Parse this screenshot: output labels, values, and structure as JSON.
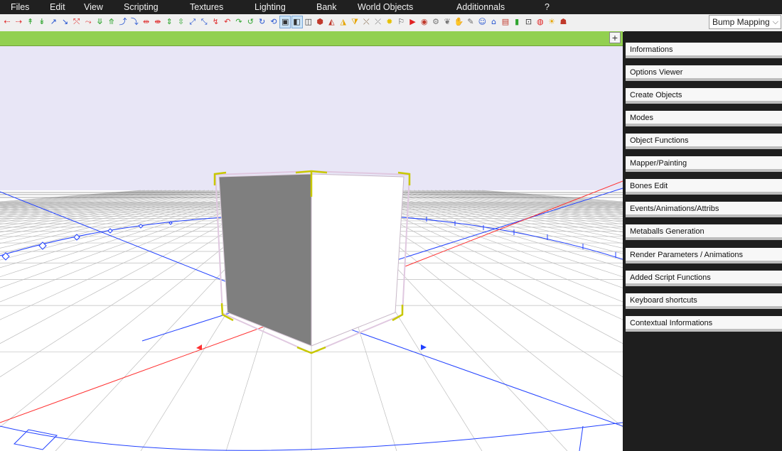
{
  "menu": [
    "Files",
    "Edit",
    "View",
    "Scripting",
    "Textures",
    "Lighting",
    "Bank",
    "World Objects",
    "Additionnals",
    "?"
  ],
  "toolbar": {
    "tools": [
      {
        "icon": "arrow-left-icon",
        "glyph": "⇠",
        "color": "#e03030"
      },
      {
        "icon": "arrow-right-icon",
        "glyph": "⇢",
        "color": "#e03030"
      },
      {
        "icon": "move-y-up-icon",
        "glyph": "↟",
        "color": "#2fa52f"
      },
      {
        "icon": "move-y-down-icon",
        "glyph": "↡",
        "color": "#2fa52f"
      },
      {
        "icon": "move-z-icon",
        "glyph": "↗",
        "color": "#2050d0"
      },
      {
        "icon": "move-z-back-icon",
        "glyph": "↘",
        "color": "#2050d0"
      },
      {
        "icon": "rotate-x-icon",
        "glyph": "⤲",
        "color": "#e03030"
      },
      {
        "icon": "rotate-x-back-icon",
        "glyph": "⤳",
        "color": "#e03030"
      },
      {
        "icon": "rotate-y-icon",
        "glyph": "⤋",
        "color": "#2fa52f"
      },
      {
        "icon": "rotate-y-back-icon",
        "glyph": "⤊",
        "color": "#2fa52f"
      },
      {
        "icon": "rotate-z-icon",
        "glyph": "⤴",
        "color": "#2050d0"
      },
      {
        "icon": "rotate-z-back-icon",
        "glyph": "⤵",
        "color": "#2050d0"
      },
      {
        "icon": "scale-x-icon",
        "glyph": "⇹",
        "color": "#e03030"
      },
      {
        "icon": "scale-x-down-icon",
        "glyph": "⇼",
        "color": "#e03030"
      },
      {
        "icon": "scale-y-icon",
        "glyph": "⇕",
        "color": "#2fa52f"
      },
      {
        "icon": "scale-y-down-icon",
        "glyph": "⇳",
        "color": "#2fa52f"
      },
      {
        "icon": "scale-z-icon",
        "glyph": "⤢",
        "color": "#2050d0"
      },
      {
        "icon": "scale-z-down-icon",
        "glyph": "⤡",
        "color": "#2050d0"
      },
      {
        "icon": "bend-x-icon",
        "glyph": "↯",
        "color": "#e03030"
      },
      {
        "icon": "bend-x-back-icon",
        "glyph": "↶",
        "color": "#e03030"
      },
      {
        "icon": "bend-y-icon",
        "glyph": "↷",
        "color": "#2fa52f"
      },
      {
        "icon": "bend-y-back-icon",
        "glyph": "↺",
        "color": "#2fa52f"
      },
      {
        "icon": "bend-z-icon",
        "glyph": "↻",
        "color": "#2050d0"
      },
      {
        "icon": "bend-z-back-icon",
        "glyph": "⟲",
        "color": "#2050d0"
      },
      {
        "icon": "select-object-icon",
        "glyph": "▣",
        "color": "#333333",
        "active": true
      },
      {
        "icon": "select-faces-icon",
        "glyph": "◧",
        "color": "#333333",
        "active": true
      },
      {
        "icon": "cube-wire-icon",
        "glyph": "◫",
        "color": "#333333"
      },
      {
        "icon": "cube-solid-icon",
        "glyph": "⬢",
        "color": "#c0392b"
      },
      {
        "icon": "cone-icon",
        "glyph": "◭",
        "color": "#c0392b"
      },
      {
        "icon": "pyramid-icon",
        "glyph": "◮",
        "color": "#e6a400"
      },
      {
        "icon": "pyramid-inverted-icon",
        "glyph": "⧩",
        "color": "#e6a400"
      },
      {
        "icon": "bone-icon",
        "glyph": "⤬",
        "color": "#7a5a3a"
      },
      {
        "icon": "skeleton-icon",
        "glyph": "⤫",
        "color": "#777777"
      },
      {
        "icon": "light-bulb-icon",
        "glyph": "✹",
        "color": "#e6c000"
      },
      {
        "icon": "flag-icon",
        "glyph": "⚐",
        "color": "#444444"
      },
      {
        "icon": "play-icon",
        "glyph": "▶",
        "color": "#e02020"
      },
      {
        "icon": "paint-bucket-icon",
        "glyph": "◉",
        "color": "#c0392b"
      },
      {
        "icon": "gear-icon",
        "glyph": "⚙",
        "color": "#777777"
      },
      {
        "icon": "brain-icon",
        "glyph": "❦",
        "color": "#777777"
      },
      {
        "icon": "hand-icon",
        "glyph": "✋",
        "color": "#888888"
      },
      {
        "icon": "brush-icon",
        "glyph": "✎",
        "color": "#6a6a6a"
      },
      {
        "icon": "user-icon",
        "glyph": "☺",
        "color": "#2050d0"
      },
      {
        "icon": "tag-icon",
        "glyph": "⌂",
        "color": "#2050d0"
      },
      {
        "icon": "document-icon",
        "glyph": "▤",
        "color": "#c0392b"
      },
      {
        "icon": "bottle-icon",
        "glyph": "▮",
        "color": "#2fa52f"
      },
      {
        "icon": "camera-icon",
        "glyph": "⊡",
        "color": "#333333"
      },
      {
        "icon": "record-icon",
        "glyph": "◍",
        "color": "#e02020"
      },
      {
        "icon": "sun-icon",
        "glyph": "☀",
        "color": "#e6a400"
      },
      {
        "icon": "robot-icon",
        "glyph": "☗",
        "color": "#c0392b"
      }
    ],
    "mode_select": "Bump Mapping"
  },
  "viewport": {
    "add_view_glyph": "+"
  },
  "panel": {
    "items": [
      "Informations",
      "Options Viewer",
      "Create Objects",
      "Modes",
      "Object Functions",
      "Mapper/Painting",
      "Bones Edit",
      "Events/Animations/Attribs",
      "Metaballs Generation",
      "Render Parameters / Animations",
      "Added Script Functions",
      "Keyboard shortcuts",
      "Contextual Informations"
    ]
  },
  "colors": {
    "sky": "#e8e6f6",
    "axis_x": "#ff3030",
    "axis_z": "#2040ff",
    "selection": "#c8c800",
    "header_green": "#92d050"
  }
}
